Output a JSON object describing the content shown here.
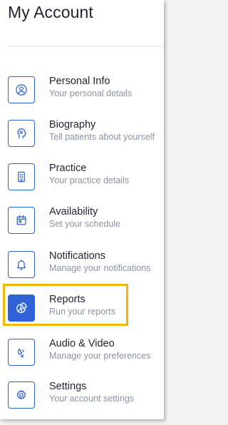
{
  "page": {
    "title": "My Account"
  },
  "menu": {
    "items": [
      {
        "label": "Personal Info",
        "sub": "Your personal details",
        "icon": "user-circle-icon"
      },
      {
        "label": "Biography",
        "sub": "Tell patients about yourself",
        "icon": "bio-head-icon"
      },
      {
        "label": "Practice",
        "sub": "Your practice details",
        "icon": "building-icon"
      },
      {
        "label": "Availability",
        "sub": "Set your schedule",
        "icon": "calendar-icon"
      },
      {
        "label": "Notifications",
        "sub": "Manage your notifications",
        "icon": "bell-icon"
      },
      {
        "label": "Reports",
        "sub": "Run your reports",
        "icon": "pie-chart-icon",
        "selected": true
      },
      {
        "label": "Audio & Video",
        "sub": "Manage your preferences",
        "icon": "audio-video-icon"
      },
      {
        "label": "Settings",
        "sub": "Your account settings",
        "icon": "gear-icon"
      }
    ]
  },
  "colors": {
    "accent": "#2f62d6",
    "highlight": "#f2b705",
    "label": "#1f2330",
    "subtext": "#8b93a3"
  }
}
